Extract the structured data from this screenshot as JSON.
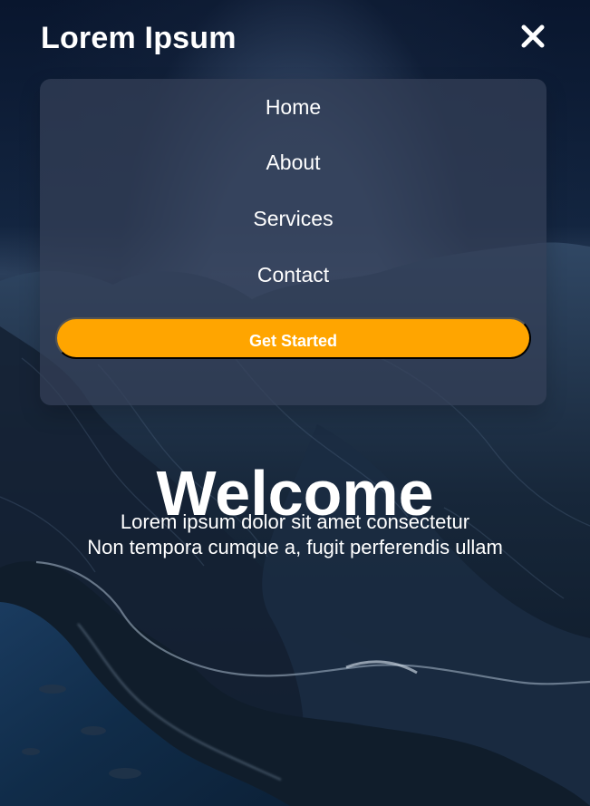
{
  "header": {
    "brand": "Lorem Ipsum",
    "close_icon": "close-icon"
  },
  "menu": {
    "items": [
      "Home",
      "About",
      "Services",
      "Contact"
    ],
    "cta": "Get Started"
  },
  "hero": {
    "title": "Welcome",
    "description_lines": [
      "Lorem ipsum dolor sit amet consectetur",
      "Non tempora cumque a, fugit perferendis ullam"
    ]
  },
  "colors": {
    "accent": "#ffa500",
    "text": "#ffffff",
    "menu_panel": "#344057"
  }
}
